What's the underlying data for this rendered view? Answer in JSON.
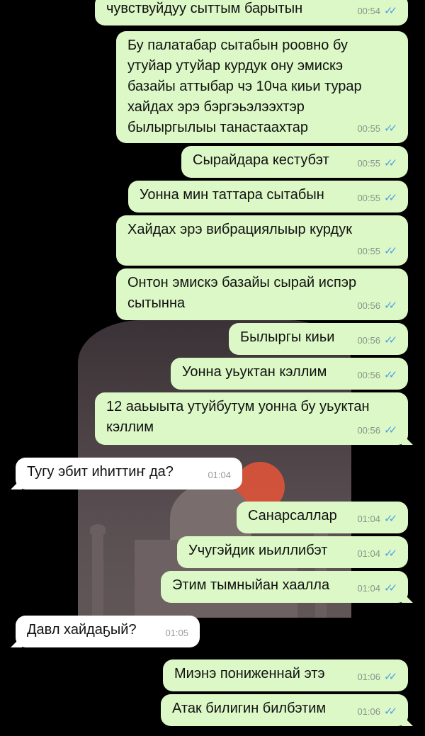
{
  "colors": {
    "outgoing": "#dcf8c6",
    "incoming": "#ffffff",
    "read_ticks": "#4fa3e0",
    "background": "#000000"
  },
  "messages": [
    {
      "text": "чувствуйдуу сыттым барытын",
      "time": "00:54",
      "ticks": "read-double-check-icon"
    },
    {
      "text": "Бу палатабар сытабын роовно бу\nутуйар утуйар курдук ону эмискэ\nбазайы аттыбар чэ 10ча киьи турар\nхайдах эрэ бэргэьэлээхтэр\nбылыргылыы танастаахтар",
      "time": "00:55",
      "ticks": "read-double-check-icon"
    },
    {
      "text": "Сырайдара кестубэт",
      "time": "00:55",
      "ticks": "read-double-check-icon"
    },
    {
      "text": "Уонна мин таттара сытабын",
      "time": "00:55",
      "ticks": "read-double-check-icon"
    },
    {
      "text": "Хайдах эрэ вибрациялыыр курдук",
      "time": "00:55",
      "ticks": "read-double-check-icon"
    },
    {
      "text": "Онтон эмискэ базайы сырай испэр\nсытынна",
      "time": "00:56",
      "ticks": "read-double-check-icon"
    },
    {
      "text": "Былыргы киьи",
      "time": "00:56",
      "ticks": "read-double-check-icon"
    },
    {
      "text": "Уонна уьуктан кэллим",
      "time": "00:56",
      "ticks": "read-double-check-icon"
    },
    {
      "text": "12 ааьыыта утуйбутум уонна бу уьуктан\nкэллим",
      "time": "00:56",
      "ticks": "read-double-check-icon"
    },
    {
      "text": "Тугу эбит иhиттиҥ да?",
      "time": "01:04"
    },
    {
      "text": "Санарсаллар",
      "time": "01:04",
      "ticks": "read-double-check-icon"
    },
    {
      "text": "Учугэйдик иьиллибэт",
      "time": "01:04",
      "ticks": "read-double-check-icon"
    },
    {
      "text": "Этим тымныйан хаалла",
      "time": "01:04",
      "ticks": "read-double-check-icon"
    },
    {
      "text": "Давл  хайдаҕый?",
      "time": "01:05"
    },
    {
      "text": "Миэнэ пониженнай этэ",
      "time": "01:06",
      "ticks": "read-double-check-icon"
    },
    {
      "text": "Атак билигин билбэтим",
      "time": "01:06",
      "ticks": "read-double-check-icon"
    }
  ]
}
